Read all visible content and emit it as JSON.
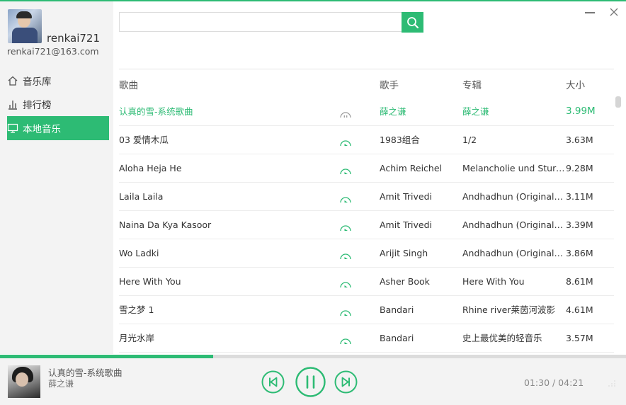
{
  "user": {
    "name": "renkai721",
    "email": "renkai721@163.com"
  },
  "nav": [
    {
      "label": "音乐库",
      "icon": "home-icon"
    },
    {
      "label": "排行榜",
      "icon": "bar-chart-icon"
    },
    {
      "label": "本地音乐",
      "icon": "monitor-icon",
      "active": true
    }
  ],
  "search": {
    "value": "",
    "placeholder": ""
  },
  "table": {
    "headers": {
      "title": "歌曲",
      "artist": "歌手",
      "album": "专辑",
      "size": "大小"
    },
    "rows": [
      {
        "title": "认真的雪-系统歌曲",
        "artist": "薛之谦",
        "album": "薛之谦",
        "size": "3.99M",
        "state": "playing"
      },
      {
        "title": "03 爱情木瓜",
        "artist": "1983组合",
        "album": "1/2",
        "size": "3.63M",
        "state": "idle"
      },
      {
        "title": "Aloha Heja He",
        "artist": "Achim Reichel",
        "album": "Melancholie und Sturmflut",
        "size": "9.28M",
        "state": "idle"
      },
      {
        "title": "Laila Laila",
        "artist": "Amit Trivedi",
        "album": "Andhadhun (Original Motion Picture Soundtrack)",
        "size": "3.11M",
        "state": "idle"
      },
      {
        "title": "Naina Da Kya Kasoor",
        "artist": "Amit Trivedi",
        "album": "Andhadhun (Original Motion Picture Soundtrack)",
        "size": "3.39M",
        "state": "idle"
      },
      {
        "title": "Wo Ladki",
        "artist": "Arijit Singh",
        "album": "Andhadhun (Original Motion Picture Soundtrack)",
        "size": "3.86M",
        "state": "idle"
      },
      {
        "title": "Here With You",
        "artist": "Asher Book",
        "album": "Here With You",
        "size": "8.61M",
        "state": "idle"
      },
      {
        "title": "雪之梦 1",
        "artist": "Bandari",
        "album": "Rhine river莱茵河波影",
        "size": "4.61M",
        "state": "idle"
      },
      {
        "title": "月光水岸",
        "artist": "Bandari",
        "album": "史上最优美的轻音乐",
        "size": "3.57M",
        "state": "idle"
      }
    ]
  },
  "player": {
    "title": "认真的雪-系统歌曲",
    "artist": "薛之谦",
    "current_time": "01:30",
    "total_time": "04:21",
    "time_display": "01:30 / 04:21",
    "progress": 0.34,
    "state": "playing"
  },
  "colors": {
    "accent": "#2dbb74",
    "sidebar_bg": "#f3f3f3"
  }
}
